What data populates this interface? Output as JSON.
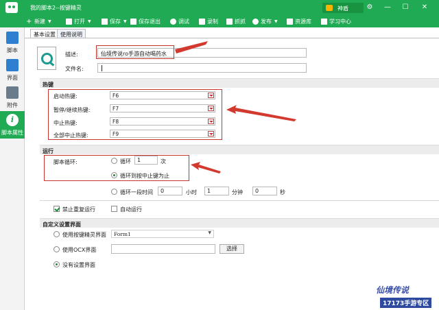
{
  "window": {
    "title": "我的脚本2--按键精灵",
    "user_label": "神盾",
    "controls": [
      "⚙",
      "—",
      "☐",
      "✕"
    ]
  },
  "toolbar": {
    "new": "新建",
    "open": "打开",
    "save": "保存",
    "save_exit": "保存退出",
    "debug": "调试",
    "record": "录制",
    "capture": "抓抓",
    "publish": "发布",
    "resources": "资源库",
    "learn": "学习中心"
  },
  "sidebar": {
    "items": [
      {
        "label": "脚本",
        "icon": "script-icon"
      },
      {
        "label": "界面",
        "icon": "interface-icon"
      },
      {
        "label": "附件",
        "icon": "attachment-icon"
      },
      {
        "label": "脚本属性",
        "icon": "info-icon"
      }
    ]
  },
  "tabs": {
    "basic": "基本设置",
    "help": "使用说明"
  },
  "basic": {
    "desc_label": "描述:",
    "desc_value": "仙境传说ro手游自动喝药水",
    "filename_label": "文件名:",
    "filename_value": ""
  },
  "hotkeys": {
    "section": "热键",
    "rows": [
      {
        "label": "启动热键:",
        "value": "F6"
      },
      {
        "label": "暂停/继续热键:",
        "value": "F7"
      },
      {
        "label": "中止热键:",
        "value": "F8"
      },
      {
        "label": "全部中止热键:",
        "value": "F9"
      }
    ]
  },
  "run": {
    "section": "运行",
    "loop_label": "脚本循环:",
    "loop_option": "循环",
    "loop_count": "1",
    "loop_unit": "次",
    "until_stop": "循环到按中止键为止",
    "period": "循环一段时间",
    "hours": "0",
    "hours_unit": "小时",
    "minutes": "1",
    "minutes_unit": "分钟",
    "seconds": "0",
    "seconds_unit": "秒",
    "no_repeat": "禁止重复运行",
    "auto_run": "自动运行"
  },
  "custom": {
    "section": "自定义设置界面",
    "use_sprite": "使用按键精灵界面",
    "form_value": "Form1",
    "use_ocx": "使用OCX界面",
    "ocx_value": "",
    "choose": "选择",
    "none": "没有设置界面"
  },
  "watermark": {
    "line1": "仙境传说",
    "line2": "17173手游专区"
  }
}
